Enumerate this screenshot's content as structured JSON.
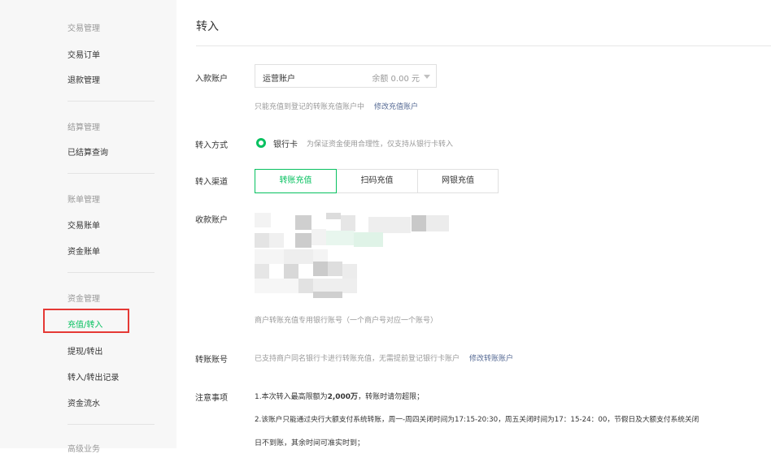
{
  "sidebar": {
    "groups": [
      {
        "title": "交易管理",
        "items": [
          "交易订单",
          "退款管理"
        ]
      },
      {
        "title": "结算管理",
        "items": [
          "已结算查询"
        ]
      },
      {
        "title": "账单管理",
        "items": [
          "交易账单",
          "资金账单"
        ]
      },
      {
        "title": "资金管理",
        "items": [
          "充值/转入",
          "提现/转出",
          "转入/转出记录",
          "资金流水"
        ]
      },
      {
        "title": "高级业务",
        "items": []
      }
    ],
    "active_item": "充值/转入"
  },
  "main": {
    "title": "转入",
    "account": {
      "label": "入款账户",
      "selected": "运营账户",
      "balance": "余额 0.00 元",
      "note": "只能充值到登记的转账充值账户中",
      "note_link": "修改充值账户"
    },
    "method": {
      "label": "转入方式",
      "option": "银行卡",
      "note": "为保证资金使用合理性，仅支持从银行卡转入"
    },
    "channel": {
      "label": "转入渠道",
      "tabs": [
        "转账充值",
        "扫码充值",
        "网银充值"
      ],
      "active": "转账充值"
    },
    "receiving": {
      "label": "收款账户",
      "note": "商户转账充值专用银行账号（一个商户号对应一个账号）"
    },
    "transfer_account": {
      "label": "转账账号",
      "note": "已支持商户同名银行卡进行转账充值，无需提前登记银行卡账户",
      "note_link": "修改转账账户"
    },
    "notice": {
      "label": "注意事项",
      "line1_pre": "1.本次转入最高限额为",
      "line1_bold": "2,000万",
      "line1_post": "，转账时请勿超限；",
      "line2": "2.该账户只能通过央行大额支付系统转账，周一-周四关闭时间为17:15-20:30，周五关闭时间为17：15-24：00，节假日及大额支付系统关闭",
      "line3": "日不到账，其余时间可准实时到；"
    }
  },
  "colors": {
    "accent": "#07c160",
    "highlight_box": "#e53935",
    "link": "#576b95"
  },
  "icons": {
    "select_caret": "caret-down-icon",
    "radio": "radio-checked-icon"
  }
}
